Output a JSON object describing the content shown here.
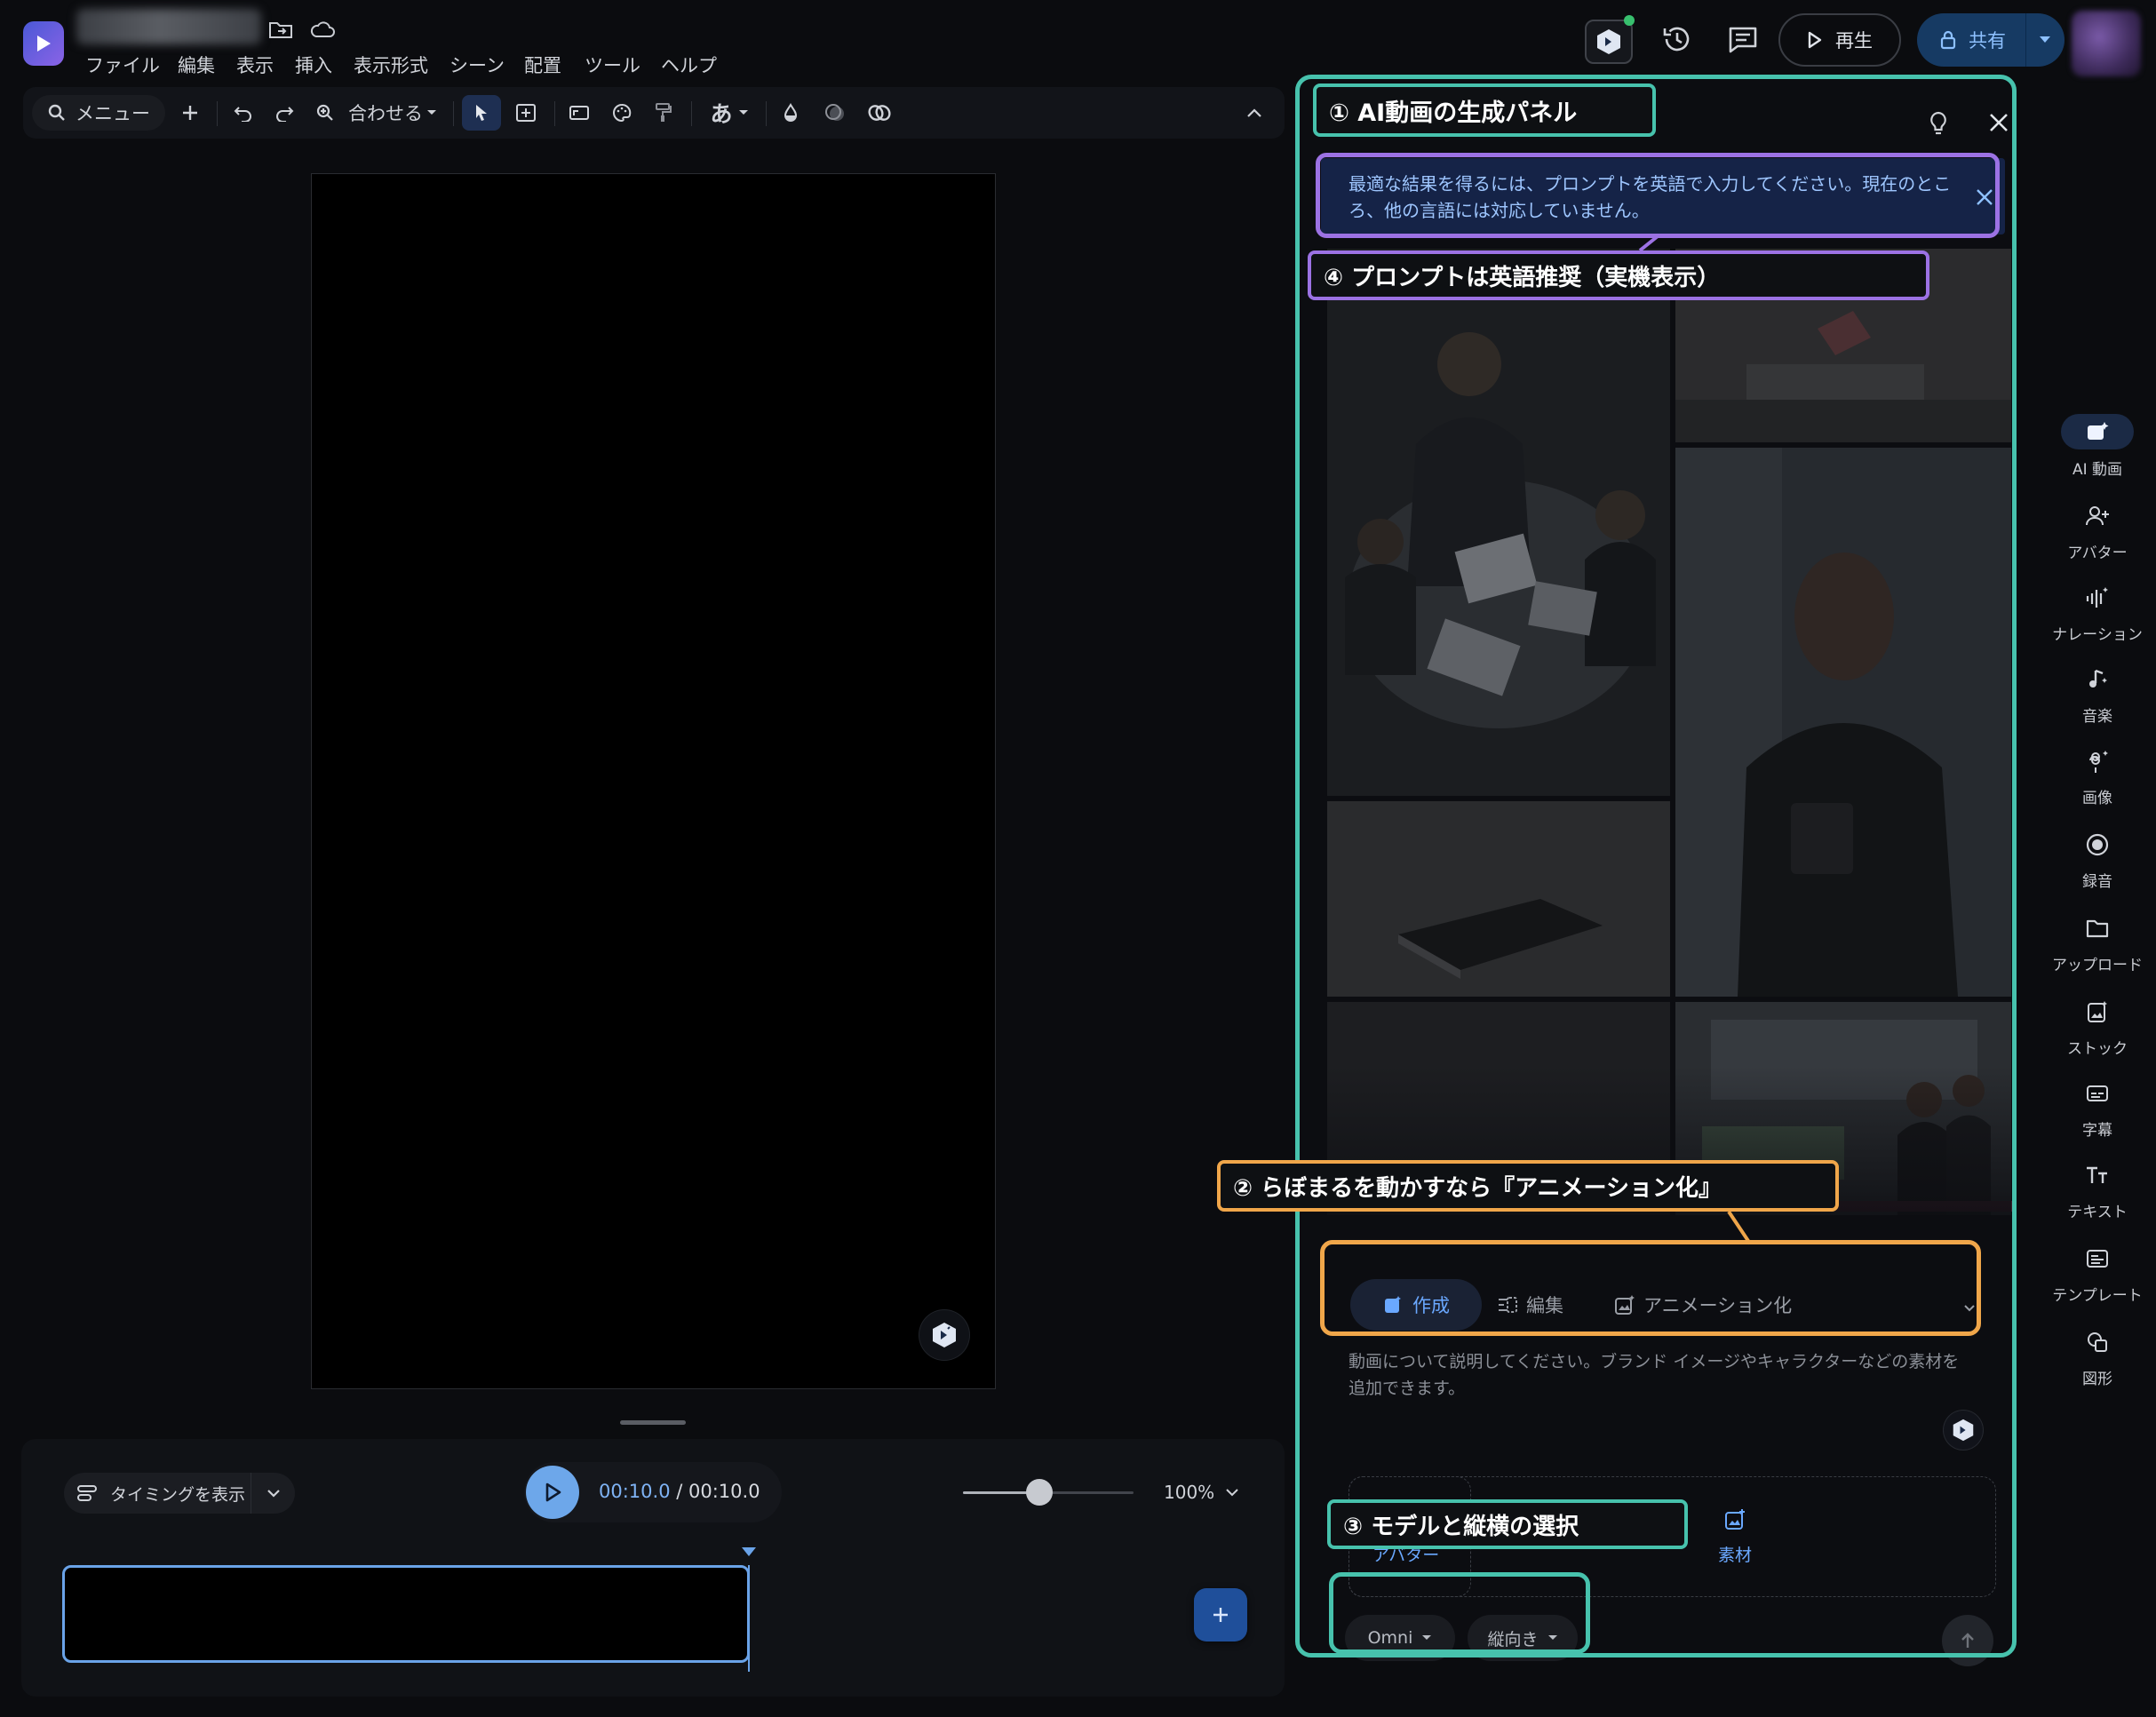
{
  "menubar": {
    "items": [
      "ファイル",
      "編集",
      "表示",
      "挿入",
      "表示形式",
      "シーン",
      "配置",
      "ツール",
      "ヘルプ"
    ]
  },
  "toolbar": {
    "search_label": "メニュー",
    "zoom_label": "合わせる",
    "text_style_glyph": "あ"
  },
  "header": {
    "play_label": "再生",
    "share_label": "共有"
  },
  "ai_panel": {
    "banner_text": "最適な結果を得るには、プロンプトを英語で入力してください。現在のところ、他の言語には対応していません。",
    "tabs": [
      "作成",
      "編集",
      "アニメーション化"
    ],
    "prompt_placeholder": "動画について説明してください。ブランド イメージやキャラクターなどの素材を追加できます。",
    "avatar_slot_label": "アバター",
    "material_label": "素材",
    "model_chip": "Omni",
    "orientation_chip": "縦向き"
  },
  "annotations": {
    "a1": "① AI動画の生成パネル",
    "a2": "② らぼまるを動かすなら『アニメーション化』",
    "a3": "③ モデルと縦横の選択",
    "a4": "④ プロンプトは英語推奨（実機表示）"
  },
  "playback": {
    "timing_label": "タイミングを表示",
    "current_time": "00:10.0",
    "separator": " / ",
    "total_time": "00:10.0",
    "zoom_percent": "100%"
  },
  "rail": {
    "items": [
      "AI 動画",
      "アバター",
      "ナレーション",
      "音楽",
      "画像",
      "録音",
      "アップロード",
      "ストック",
      "字幕",
      "テキスト",
      "テンプレート",
      "図形"
    ]
  },
  "colors": {
    "teal": "#47c2ad",
    "purple": "#9c72e4",
    "orange": "#f0a64a",
    "accent_blue": "#6aa8ff"
  }
}
